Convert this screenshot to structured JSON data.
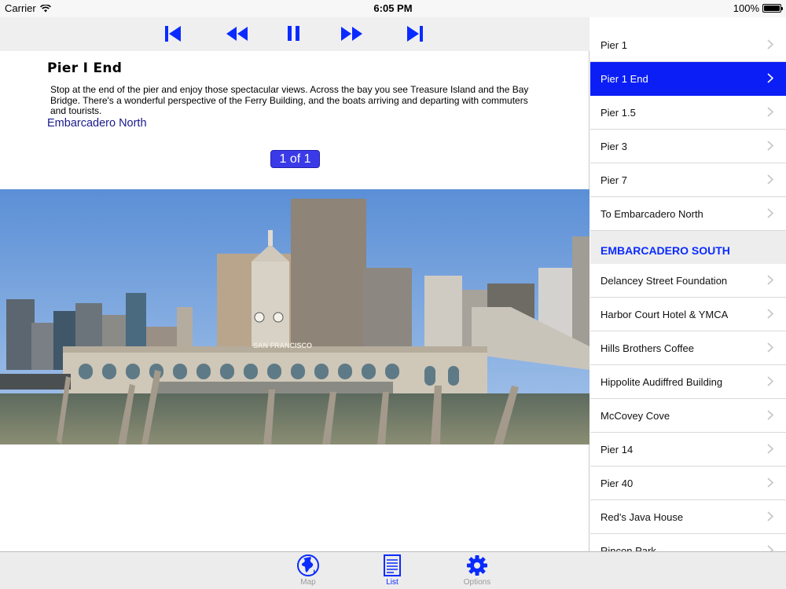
{
  "status": {
    "carrier": "Carrier",
    "time": "6:05 PM",
    "battery": "100%"
  },
  "detail": {
    "title": "Pier I End",
    "description": "Stop at the end of the pier and enjoy those spectacular views. Across the bay you see Treasure Island and the Bay Bridge. There's a wonderful perspective of the Ferry Building, and the boats arriving and departing with commuters and tourists.",
    "link": "Embarcadero North",
    "pager": "1 of 1",
    "photo_sign": "SAN FRANCISCO"
  },
  "player": {
    "icons": [
      "skip-to-start-icon",
      "rewind-icon",
      "pause-icon",
      "fast-forward-icon",
      "skip-to-end-icon"
    ]
  },
  "list": {
    "group1": [
      {
        "label": "Pier 1",
        "selected": false
      },
      {
        "label": "Pier 1 End",
        "selected": true
      },
      {
        "label": "Pier 1.5",
        "selected": false
      },
      {
        "label": "Pier 3",
        "selected": false
      },
      {
        "label": "Pier 7",
        "selected": false
      },
      {
        "label": "To Embarcadero North",
        "selected": false
      }
    ],
    "section": "EMBARCADERO SOUTH",
    "group2": [
      {
        "label": "Delancey Street Foundation"
      },
      {
        "label": "Harbor Court Hotel & YMCA"
      },
      {
        "label": "Hills Brothers Coffee"
      },
      {
        "label": "Hippolite Audiffred Building"
      },
      {
        "label": "McCovey Cove"
      },
      {
        "label": "Pier 14"
      },
      {
        "label": "Pier 40"
      },
      {
        "label": "Red's Java House"
      },
      {
        "label": "Rincon Park"
      }
    ]
  },
  "tabs": [
    {
      "label": "Map",
      "icon": "globe-icon",
      "active": false
    },
    {
      "label": "List",
      "icon": "document-icon",
      "active": true
    },
    {
      "label": "Options",
      "icon": "gear-icon",
      "active": false
    }
  ],
  "colors": {
    "accent": "#0a1ef5",
    "link": "#1a1a8c",
    "pager": "#3a3ae8"
  }
}
